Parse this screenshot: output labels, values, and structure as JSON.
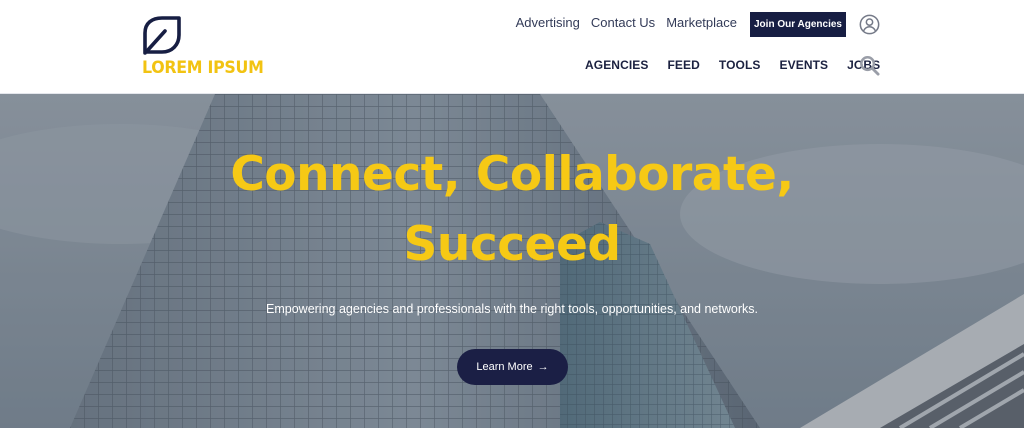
{
  "brand": {
    "name": "LOREM IPSUM",
    "logo_icon": "leaf-icon",
    "accent_color": "#f2c312",
    "navy_color": "#171e43"
  },
  "header": {
    "top_links": [
      "Advertising",
      "Contact Us",
      "Marketplace"
    ],
    "join_label": "Join Our Agencies",
    "user_icon": "user-circle-icon",
    "nav": [
      "AGENCIES",
      "FEED",
      "TOOLS",
      "EVENTS",
      "JOBS"
    ],
    "search_icon": "search-icon"
  },
  "hero": {
    "title_line1": "Connect, Collaborate,",
    "title_line2": "Succeed",
    "subtitle": "Empowering agencies and professionals with the right tools, opportunities, and networks.",
    "cta_label": "Learn More",
    "cta_icon": "arrow-right-icon",
    "background": "office-building-photo"
  }
}
